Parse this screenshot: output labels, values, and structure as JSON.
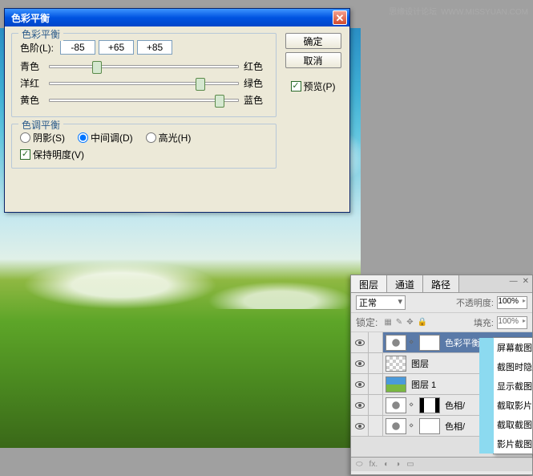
{
  "watermark": {
    "text": "思缘设计论坛",
    "url": "WWW.MISSYUAN.COM"
  },
  "dialog": {
    "title": "色彩平衡",
    "group1_legend": "色彩平衡",
    "levels_label": "色阶(L):",
    "levels": [
      "-85",
      "+65",
      "+85"
    ],
    "sliders": [
      {
        "left": "青色",
        "right": "红色",
        "pos": 25
      },
      {
        "left": "洋红",
        "right": "绿色",
        "pos": 80
      },
      {
        "left": "黄色",
        "right": "蓝色",
        "pos": 90
      }
    ],
    "group2_legend": "色调平衡",
    "tones": [
      {
        "label": "阴影(S)",
        "checked": false
      },
      {
        "label": "中间调(D)",
        "checked": true
      },
      {
        "label": "高光(H)",
        "checked": false
      }
    ],
    "preserve_lum": "保持明度(V)",
    "ok": "确定",
    "cancel": "取消",
    "preview": "预览(P)"
  },
  "panel": {
    "tabs": [
      "图层",
      "通道",
      "路径"
    ],
    "blend_mode": "正常",
    "opacity_label": "不透明度:",
    "opacity_value": "100%",
    "lock_label": "锁定:",
    "fill_label": "填充:",
    "fill_value": "100%",
    "layers": [
      {
        "name": "色彩平衡",
        "type": "adj",
        "active": true
      },
      {
        "name": "图层",
        "type": "trans"
      },
      {
        "name": "图层 1",
        "type": "sky"
      },
      {
        "name": "色相/",
        "type": "adj_mask"
      },
      {
        "name": "色相/",
        "type": "adj"
      }
    ]
  },
  "context_menu": {
    "items": [
      "屏幕截图",
      "截图时隐",
      "显示截图",
      "截取影片",
      "截取截图",
      "影片截图"
    ]
  }
}
